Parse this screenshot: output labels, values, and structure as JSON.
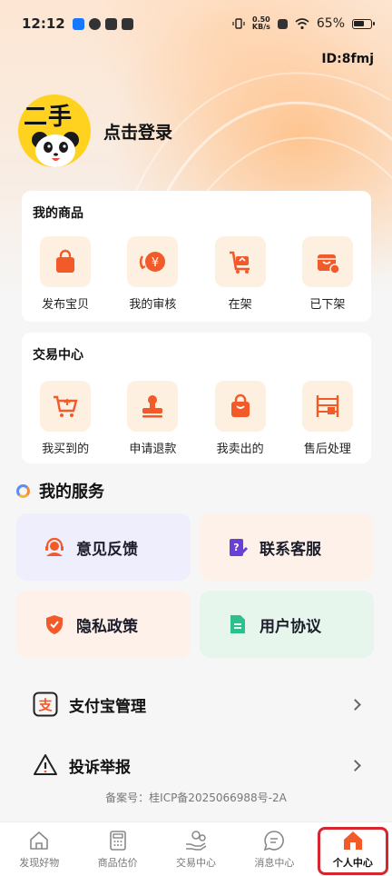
{
  "status_bar": {
    "time": "12:12",
    "net_speed_value": "0.50",
    "net_speed_unit": "KB/s",
    "battery": "65%"
  },
  "header": {
    "user_id": "ID:8fmj",
    "avatar_text": "二手",
    "login_label": "点击登录"
  },
  "my_goods": {
    "title": "我的商品",
    "items": [
      {
        "label": "发布宝贝",
        "icon": "shopping-bag-icon"
      },
      {
        "label": "我的审核",
        "icon": "yen-coin-icon"
      },
      {
        "label": "在架",
        "icon": "shelf-cart-icon"
      },
      {
        "label": "已下架",
        "icon": "box-remove-icon"
      }
    ]
  },
  "trade_center": {
    "title": "交易中心",
    "items": [
      {
        "label": "我买到的",
        "icon": "cart-icon"
      },
      {
        "label": "申请退款",
        "icon": "stamp-icon"
      },
      {
        "label": "我卖出的",
        "icon": "sold-bag-icon"
      },
      {
        "label": "售后处理",
        "icon": "shelf-icon"
      }
    ]
  },
  "services": {
    "title": "我的服务",
    "items": [
      {
        "label": "意见反馈",
        "icon": "headset-icon",
        "bg": "#eeeefc"
      },
      {
        "label": "联系客服",
        "icon": "edit-doc-icon",
        "bg": "#fdf1ea"
      },
      {
        "label": "隐私政策",
        "icon": "shield-icon",
        "bg": "#fdf1ea"
      },
      {
        "label": "用户协议",
        "icon": "document-icon",
        "bg": "#e6f6ec"
      }
    ]
  },
  "links": {
    "alipay": "支付宝管理",
    "report": "投诉举报"
  },
  "icp": "备案号：桂ICP备2025066988号-2A",
  "tabbar": {
    "items": [
      {
        "label": "发现好物",
        "icon": "home-outline-icon"
      },
      {
        "label": "商品估价",
        "icon": "calculator-icon"
      },
      {
        "label": "交易中心",
        "icon": "hand-coins-icon"
      },
      {
        "label": "消息中心",
        "icon": "chat-icon"
      },
      {
        "label": "个人中心",
        "icon": "home-filled-icon"
      }
    ],
    "active_index": 4
  },
  "colors": {
    "accent": "#f25a2a",
    "active_highlight": "#d6262e",
    "icon_tile": "#fdf0e1"
  }
}
